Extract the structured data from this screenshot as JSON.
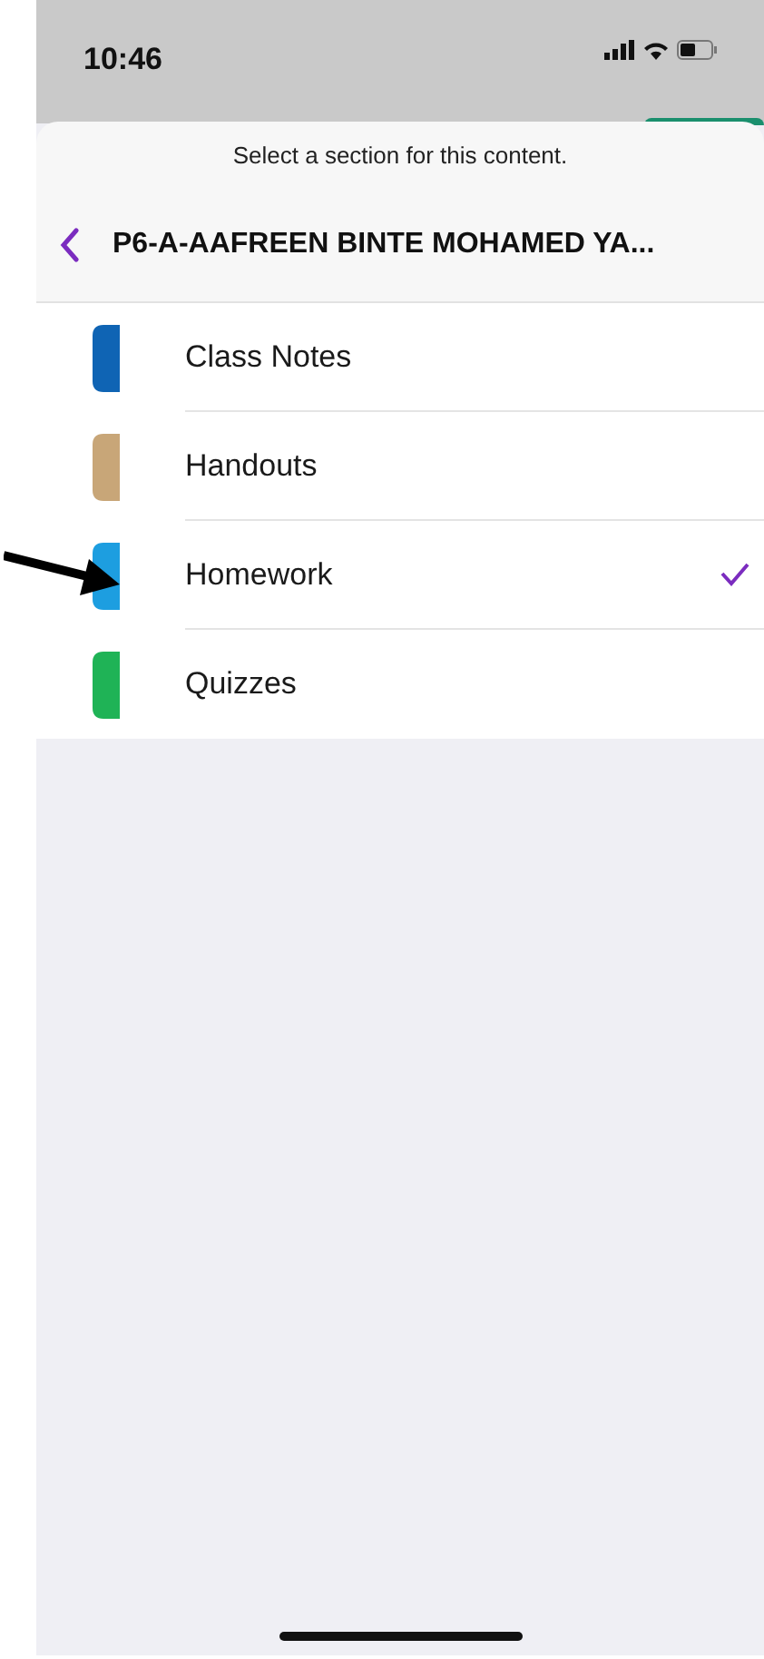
{
  "status_bar": {
    "time": "10:46"
  },
  "sheet": {
    "prompt": "Select a section for this content.",
    "notebook_title": "P6-A-AAFREEN BINTE MOHAMED YA..."
  },
  "sections": [
    {
      "label": "Class Notes",
      "color": "#0f64b4",
      "selected": false
    },
    {
      "label": "Handouts",
      "color": "#c8a678",
      "selected": false
    },
    {
      "label": "Homework",
      "color": "#1d9ee0",
      "selected": true
    },
    {
      "label": "Quizzes",
      "color": "#1fb356",
      "selected": false
    }
  ]
}
